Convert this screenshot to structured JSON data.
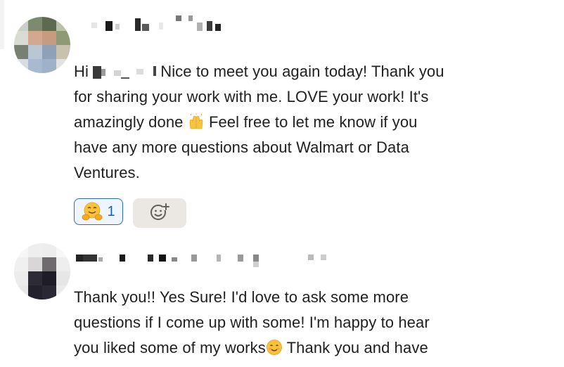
{
  "messages": [
    {
      "avatar_icon": "blurred-avatar-icon",
      "line1_before": "Hi",
      "line1_after": "Nice to meet you again today! Thank you",
      "line2": "for sharing your work with me. LOVE your work! It's",
      "line3_before": "amazingly done",
      "line3_after": "Feel free to let me know if you",
      "line4": "have any more questions about Walmart or Data",
      "line5": "Ventures.",
      "reactions": [
        {
          "emoji_icon": "hugging-face-icon",
          "count": "1"
        }
      ],
      "add_reaction_icon": "add-reaction-icon"
    },
    {
      "avatar_icon": "blurred-avatar-icon",
      "line1": "Thank you!! Yes Sure! I'd love to ask some more",
      "line2": "questions if I come up with some! I'm happy to hear",
      "line3_before": "you liked some of my works",
      "line3_after": " Thank you and have"
    }
  ],
  "colors": {
    "reaction_border": "#2b6cc4",
    "reaction_count": "#1b5fb8",
    "add_reaction_bg": "#ebe8e3",
    "text": "#1f1f1f"
  }
}
